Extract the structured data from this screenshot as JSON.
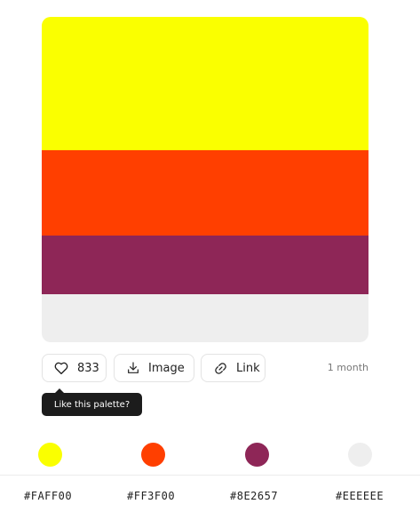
{
  "colors": {
    "c1": "#FAFF00",
    "c2": "#FF3F00",
    "c3": "#8E2657",
    "c4": "#EEEEEE"
  },
  "actions": {
    "like_count": "833",
    "image_label": "Image",
    "link_label": "Link",
    "time": "1 month"
  },
  "tooltip": {
    "text": "Like this palette?"
  },
  "hex_codes": [
    "#FAFF00",
    "#FF3F00",
    "#8E2657",
    "#EEEEEE"
  ],
  "icons": {
    "like": "heart-icon",
    "image": "download-icon",
    "link": "link-icon"
  }
}
